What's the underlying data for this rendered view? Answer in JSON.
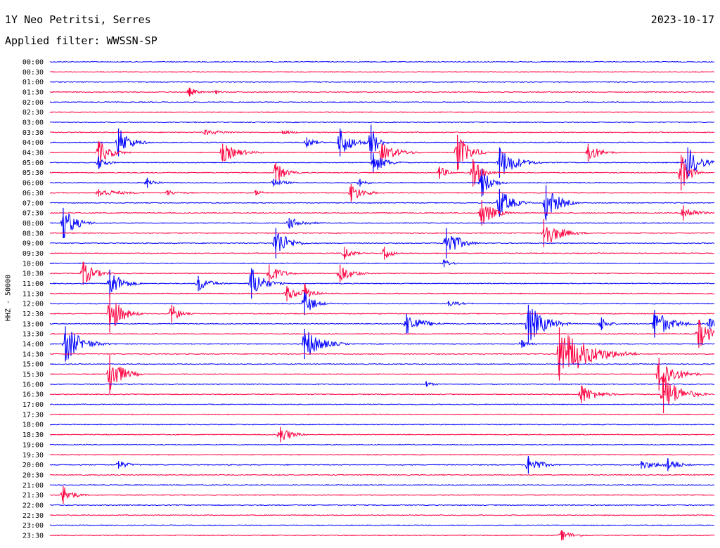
{
  "header": {
    "station": "1Y Neo Petritsi, Serres",
    "date": "2023-10-17",
    "filter": "Applied filter: WWSSN-SP",
    "channel_label": "HHZ - 50000"
  },
  "colors": {
    "even_trace": "#0000ff",
    "odd_trace": "#ff0040",
    "background": "#ffffff",
    "text": "#000000"
  },
  "chart_data": {
    "type": "helicorder",
    "ylabel": "HHZ - 50000",
    "row_labels": [
      "00:00",
      "00:30",
      "01:00",
      "01:30",
      "02:00",
      "02:30",
      "03:00",
      "03:30",
      "04:00",
      "04:30",
      "05:00",
      "05:30",
      "06:00",
      "06:30",
      "07:00",
      "07:30",
      "08:00",
      "08:30",
      "09:00",
      "09:30",
      "10:00",
      "10:30",
      "11:00",
      "11:30",
      "12:00",
      "12:30",
      "13:00",
      "13:30",
      "14:00",
      "14:30",
      "15:00",
      "15:30",
      "16:00",
      "16:30",
      "17:00",
      "17:30",
      "18:00",
      "18:30",
      "19:00",
      "19:30",
      "20:00",
      "20:30",
      "21:00",
      "21:30",
      "22:00",
      "22:30",
      "23:00",
      "23:30"
    ],
    "minutes_per_row": 30,
    "events": [
      {
        "row": 3,
        "minute": 6.3,
        "amplitude": 7,
        "duration": 1
      },
      {
        "row": 3,
        "minute": 7.5,
        "amplitude": 3,
        "duration": 1
      },
      {
        "row": 7,
        "minute": 7,
        "amplitude": 4,
        "duration": 3
      },
      {
        "row": 7,
        "minute": 10.5,
        "amplitude": 3,
        "duration": 2
      },
      {
        "row": 8,
        "minute": 3.1,
        "amplitude": 22,
        "duration": 1.5
      },
      {
        "row": 8,
        "minute": 11.6,
        "amplitude": 8,
        "duration": 1
      },
      {
        "row": 8,
        "minute": 13.1,
        "amplitude": 22,
        "duration": 1.5
      },
      {
        "row": 8,
        "minute": 14.5,
        "amplitude": 28,
        "duration": 0.8
      },
      {
        "row": 9,
        "minute": 2.2,
        "amplitude": 18,
        "duration": 1.5
      },
      {
        "row": 9,
        "minute": 7.8,
        "amplitude": 14,
        "duration": 2
      },
      {
        "row": 9,
        "minute": 15,
        "amplitude": 14,
        "duration": 2
      },
      {
        "row": 9,
        "minute": 18.4,
        "amplitude": 28,
        "duration": 1.5
      },
      {
        "row": 9,
        "minute": 24.3,
        "amplitude": 14,
        "duration": 1.5
      },
      {
        "row": 10,
        "minute": 2.2,
        "amplitude": 10,
        "duration": 1
      },
      {
        "row": 10,
        "minute": 14.6,
        "amplitude": 16,
        "duration": 1.5
      },
      {
        "row": 10,
        "minute": 20.3,
        "amplitude": 24,
        "duration": 2
      },
      {
        "row": 10,
        "minute": 28.8,
        "amplitude": 24,
        "duration": 1.5
      },
      {
        "row": 11,
        "minute": 10.2,
        "amplitude": 16,
        "duration": 1.2
      },
      {
        "row": 11,
        "minute": 17.6,
        "amplitude": 10,
        "duration": 1
      },
      {
        "row": 11,
        "minute": 19.1,
        "amplitude": 22,
        "duration": 1.2
      },
      {
        "row": 11,
        "minute": 28.5,
        "amplitude": 28,
        "duration": 1
      },
      {
        "row": 12,
        "minute": 4.4,
        "amplitude": 8,
        "duration": 1
      },
      {
        "row": 12,
        "minute": 10.1,
        "amplitude": 6,
        "duration": 1.5
      },
      {
        "row": 12,
        "minute": 14,
        "amplitude": 6,
        "duration": 1
      },
      {
        "row": 12,
        "minute": 19.5,
        "amplitude": 22,
        "duration": 1.2
      },
      {
        "row": 13,
        "minute": 2.2,
        "amplitude": 6,
        "duration": 3
      },
      {
        "row": 13,
        "minute": 5.3,
        "amplitude": 4,
        "duration": 2
      },
      {
        "row": 13,
        "minute": 9.3,
        "amplitude": 4,
        "duration": 1
      },
      {
        "row": 13,
        "minute": 13.6,
        "amplitude": 14,
        "duration": 1.5
      },
      {
        "row": 14,
        "minute": 20.3,
        "amplitude": 22,
        "duration": 1.5
      },
      {
        "row": 14,
        "minute": 22.4,
        "amplitude": 28,
        "duration": 1.5
      },
      {
        "row": 15,
        "minute": 19.5,
        "amplitude": 20,
        "duration": 1.5
      },
      {
        "row": 15,
        "minute": 28.6,
        "amplitude": 12,
        "duration": 1.5
      },
      {
        "row": 16,
        "minute": 0.6,
        "amplitude": 24,
        "duration": 1.5
      },
      {
        "row": 16,
        "minute": 10.8,
        "amplitude": 8,
        "duration": 2
      },
      {
        "row": 17,
        "minute": 22.3,
        "amplitude": 22,
        "duration": 2
      },
      {
        "row": 18,
        "minute": 10.2,
        "amplitude": 24,
        "duration": 1.5
      },
      {
        "row": 18,
        "minute": 17.9,
        "amplitude": 24,
        "duration": 1.5
      },
      {
        "row": 19,
        "minute": 13.3,
        "amplitude": 10,
        "duration": 1
      },
      {
        "row": 19,
        "minute": 15.1,
        "amplitude": 10,
        "duration": 1
      },
      {
        "row": 20,
        "minute": 17.8,
        "amplitude": 6,
        "duration": 1
      },
      {
        "row": 21,
        "minute": 1.5,
        "amplitude": 18,
        "duration": 1.5
      },
      {
        "row": 21,
        "minute": 9.9,
        "amplitude": 14,
        "duration": 1.5
      },
      {
        "row": 21,
        "minute": 13.1,
        "amplitude": 14,
        "duration": 1.5
      },
      {
        "row": 22,
        "minute": 2.7,
        "amplitude": 22,
        "duration": 1.5
      },
      {
        "row": 22,
        "minute": 6.7,
        "amplitude": 12,
        "duration": 1.5
      },
      {
        "row": 22,
        "minute": 9.1,
        "amplitude": 24,
        "duration": 1.5
      },
      {
        "row": 23,
        "minute": 10.7,
        "amplitude": 12,
        "duration": 1.2
      },
      {
        "row": 23,
        "minute": 11.5,
        "amplitude": 16,
        "duration": 1
      },
      {
        "row": 24,
        "minute": 11.5,
        "amplitude": 18,
        "duration": 1.2
      },
      {
        "row": 24,
        "minute": 18,
        "amplitude": 4,
        "duration": 2
      },
      {
        "row": 25,
        "minute": 2.7,
        "amplitude": 30,
        "duration": 1.5
      },
      {
        "row": 25,
        "minute": 5.5,
        "amplitude": 14,
        "duration": 1
      },
      {
        "row": 26,
        "minute": 16.1,
        "amplitude": 16,
        "duration": 2
      },
      {
        "row": 26,
        "minute": 21.6,
        "amplitude": 30,
        "duration": 2
      },
      {
        "row": 26,
        "minute": 24.9,
        "amplitude": 10,
        "duration": 1
      },
      {
        "row": 26,
        "minute": 27.3,
        "amplitude": 22,
        "duration": 2
      },
      {
        "row": 26,
        "minute": 29.8,
        "amplitude": 8,
        "duration": 1
      },
      {
        "row": 27,
        "minute": 29.3,
        "amplitude": 22,
        "duration": 1.5
      },
      {
        "row": 28,
        "minute": 0.7,
        "amplitude": 28,
        "duration": 2
      },
      {
        "row": 28,
        "minute": 11.5,
        "amplitude": 24,
        "duration": 2
      },
      {
        "row": 28,
        "minute": 21.3,
        "amplitude": 6,
        "duration": 1
      },
      {
        "row": 29,
        "minute": 23,
        "amplitude": 42,
        "duration": 3.5
      },
      {
        "row": 31,
        "minute": 2.7,
        "amplitude": 30,
        "duration": 1.5
      },
      {
        "row": 31,
        "minute": 27.5,
        "amplitude": 26,
        "duration": 2
      },
      {
        "row": 32,
        "minute": 17,
        "amplitude": 4,
        "duration": 1
      },
      {
        "row": 33,
        "minute": 24,
        "amplitude": 14,
        "duration": 2
      },
      {
        "row": 33,
        "minute": 27.7,
        "amplitude": 30,
        "duration": 2
      },
      {
        "row": 37,
        "minute": 10.4,
        "amplitude": 12,
        "duration": 1.5
      },
      {
        "row": 40,
        "minute": 3.1,
        "amplitude": 6,
        "duration": 1.5
      },
      {
        "row": 40,
        "minute": 21.6,
        "amplitude": 14,
        "duration": 1.5
      },
      {
        "row": 40,
        "minute": 26.7,
        "amplitude": 6,
        "duration": 3
      },
      {
        "row": 40,
        "minute": 27.9,
        "amplitude": 10,
        "duration": 1.5
      },
      {
        "row": 43,
        "minute": 0.6,
        "amplitude": 14,
        "duration": 1.2
      },
      {
        "row": 47,
        "minute": 23.1,
        "amplitude": 8,
        "duration": 1.5
      }
    ]
  }
}
